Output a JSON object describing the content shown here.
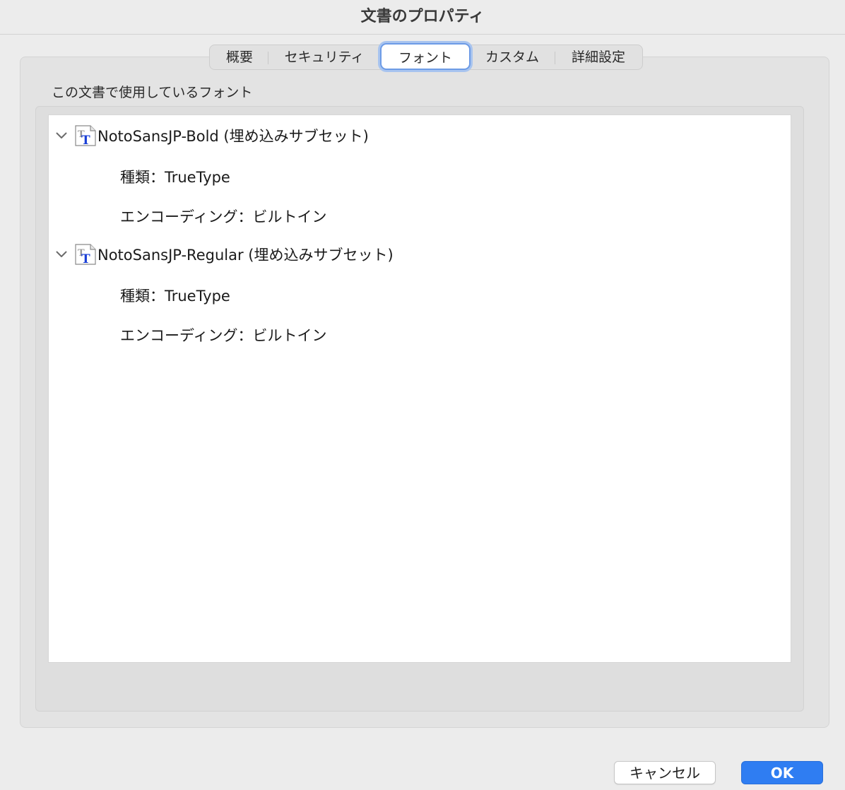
{
  "window": {
    "title": "文書のプロパティ"
  },
  "tabs": [
    {
      "label": "概要"
    },
    {
      "label": "セキュリティ"
    },
    {
      "label": "フォント",
      "active": true
    },
    {
      "label": "カスタム"
    },
    {
      "label": "詳細設定"
    }
  ],
  "section_label": "この文書で使用しているフォント",
  "fonts": [
    {
      "name": "NotoSansJP-Bold (埋め込みサブセット)",
      "icon": "truetype-font-icon",
      "expanded": true,
      "type_line": "種類：TrueType",
      "encoding_line": "エンコーディング：ビルトイン"
    },
    {
      "name": "NotoSansJP-Regular (埋め込みサブセット)",
      "icon": "truetype-font-icon",
      "expanded": true,
      "type_line": "種類：TrueType",
      "encoding_line": "エンコーディング：ビルトイン"
    }
  ],
  "buttons": {
    "cancel": "キャンセル",
    "ok": "OK"
  },
  "colors": {
    "accent": "#2f7df2",
    "focus_ring": "#6d9be6"
  }
}
